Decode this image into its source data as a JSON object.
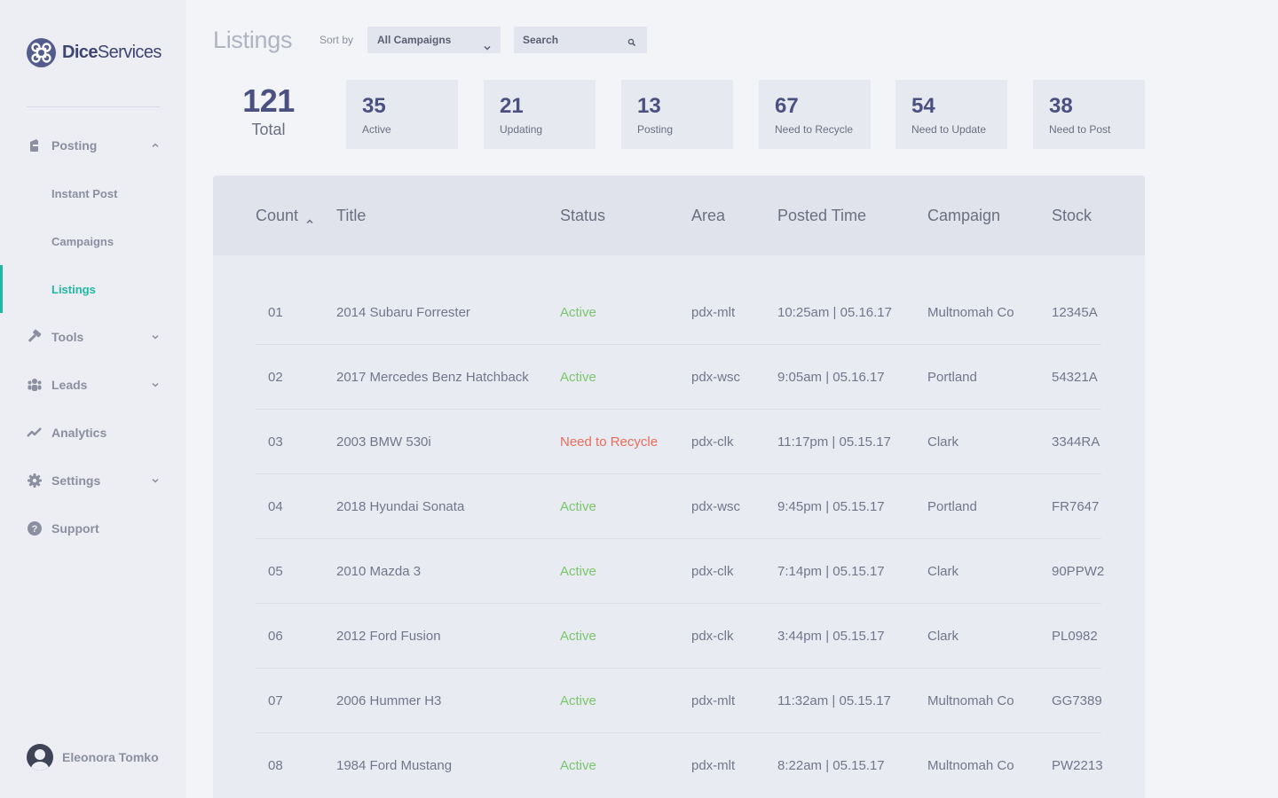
{
  "brand": {
    "name_bold": "Dice",
    "name_rest": "Services",
    "accent": "#1fb8a3",
    "logo_color": "#535c8c"
  },
  "sidebar": {
    "items": [
      {
        "label": "Posting",
        "icon": "posting-icon",
        "expanded": true
      },
      {
        "label": "Instant Post"
      },
      {
        "label": "Campaigns"
      },
      {
        "label": "Listings",
        "active": true
      },
      {
        "label": "Tools",
        "icon": "hammer-icon",
        "expanded": false
      },
      {
        "label": "Leads",
        "icon": "people-icon",
        "expanded": false
      },
      {
        "label": "Analytics",
        "icon": "chart-line-icon"
      },
      {
        "label": "Settings",
        "icon": "gear-icon",
        "expanded": false
      },
      {
        "label": "Support",
        "icon": "help-icon"
      }
    ],
    "user": {
      "name": "Eleonora Tomko"
    }
  },
  "header": {
    "title": "Listings",
    "sort_label": "Sort by",
    "sort_value": "All Campaigns",
    "search_placeholder": "Search"
  },
  "stats": {
    "total": {
      "value": "121",
      "label": "Total"
    },
    "cards": [
      {
        "value": "35",
        "label": "Active"
      },
      {
        "value": "21",
        "label": "Updating"
      },
      {
        "value": "13",
        "label": "Posting"
      },
      {
        "value": "67",
        "label": "Need to Recycle"
      },
      {
        "value": "54",
        "label": "Need to Update"
      },
      {
        "value": "38",
        "label": "Need to Post"
      }
    ]
  },
  "table": {
    "columns": [
      "Count",
      "Title",
      "Status",
      "Area",
      "Posted Time",
      "Campaign",
      "Stock"
    ],
    "rows": [
      [
        "01",
        "2014 Subaru Forrester",
        "Active",
        "pdx-mlt",
        "10:25am  |  05.16.17",
        "Multnomah Co",
        "12345A"
      ],
      [
        "02",
        "2017 Mercedes Benz Hatchback",
        "Active",
        "pdx-wsc",
        "9:05am  |  05.16.17",
        "Portland",
        "54321A"
      ],
      [
        "03",
        "2003 BMW 530i",
        "Need to Recycle",
        "pdx-clk",
        "11:17pm  |  05.15.17",
        "Clark",
        "3344RA"
      ],
      [
        "04",
        "2018 Hyundai Sonata",
        "Active",
        "pdx-wsc",
        "9:45pm  |  05.15.17",
        "Portland",
        "FR7647"
      ],
      [
        "05",
        "2010 Mazda 3",
        "Active",
        "pdx-clk",
        "7:14pm  |  05.15.17",
        "Clark",
        "90PPW2"
      ],
      [
        "06",
        "2012 Ford Fusion",
        "Active",
        "pdx-clk",
        "3:44pm  |  05.15.17",
        "Clark",
        "PL0982"
      ],
      [
        "07",
        "2006 Hummer H3",
        "Active",
        "pdx-mlt",
        "11:32am  |  05.15.17",
        "Multnomah Co",
        "GG7389"
      ],
      [
        "08",
        "1984 Ford Mustang",
        "Active",
        "pdx-mlt",
        "8:22am  |  05.15.17",
        "Multnomah Co",
        "PW2213"
      ]
    ]
  },
  "colors": {
    "active": "#7ac66b",
    "recycle": "#ec6c5a",
    "heading": "#4a5180"
  }
}
